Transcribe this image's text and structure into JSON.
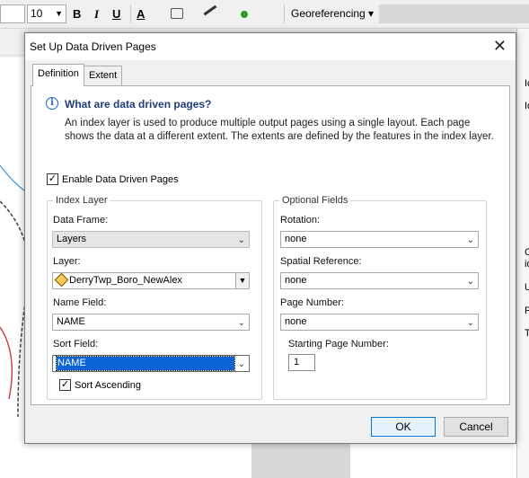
{
  "toolbar": {
    "font_size": "10",
    "bold_label": "B",
    "italic_label": "I",
    "underline_label": "U",
    "font_color_label": "A",
    "georef_label": "Georeferencing ▾",
    "accent_color": "#0a64d6"
  },
  "background": {
    "right_panel_texts": [
      "Ic",
      "Ic",
      "Cl",
      "id",
      "Us",
      "Pr",
      "Th"
    ]
  },
  "dialog": {
    "title": "Set Up Data Driven Pages",
    "close_glyph": "✕",
    "tabs": [
      {
        "label": "Definition",
        "active": true
      },
      {
        "label": "Extent",
        "active": false
      }
    ],
    "info": {
      "icon": "info-icon",
      "icon_glyph": "i",
      "title": "What are data driven pages?",
      "text": "An index layer is used to produce multiple output pages using a single layout.  Each page shows the data at a different extent.  The extents are defined by the features in the index layer."
    },
    "enable": {
      "label": "Enable Data Driven Pages",
      "checked": true,
      "check_glyph": "✓"
    },
    "index_layer": {
      "group_title": "Index Layer",
      "data_frame_label": "Data Frame:",
      "data_frame_value": "Layers",
      "layer_label": "Layer:",
      "layer_value": "DerryTwp_Boro_NewAlex",
      "name_field_label": "Name Field:",
      "name_field_value": "NAME",
      "sort_field_label": "Sort Field:",
      "sort_field_value": "NAME",
      "sort_ascending_label": "Sort Ascending",
      "sort_ascending_checked": true
    },
    "optional_fields": {
      "group_title": "Optional Fields",
      "rotation_label": "Rotation:",
      "rotation_value": "none",
      "spatial_ref_label": "Spatial Reference:",
      "spatial_ref_value": "none",
      "page_number_label": "Page Number:",
      "page_number_value": "none",
      "starting_page_label": "Starting Page Number:",
      "starting_page_value": "1"
    },
    "buttons": {
      "ok": "OK",
      "cancel": "Cancel"
    }
  }
}
